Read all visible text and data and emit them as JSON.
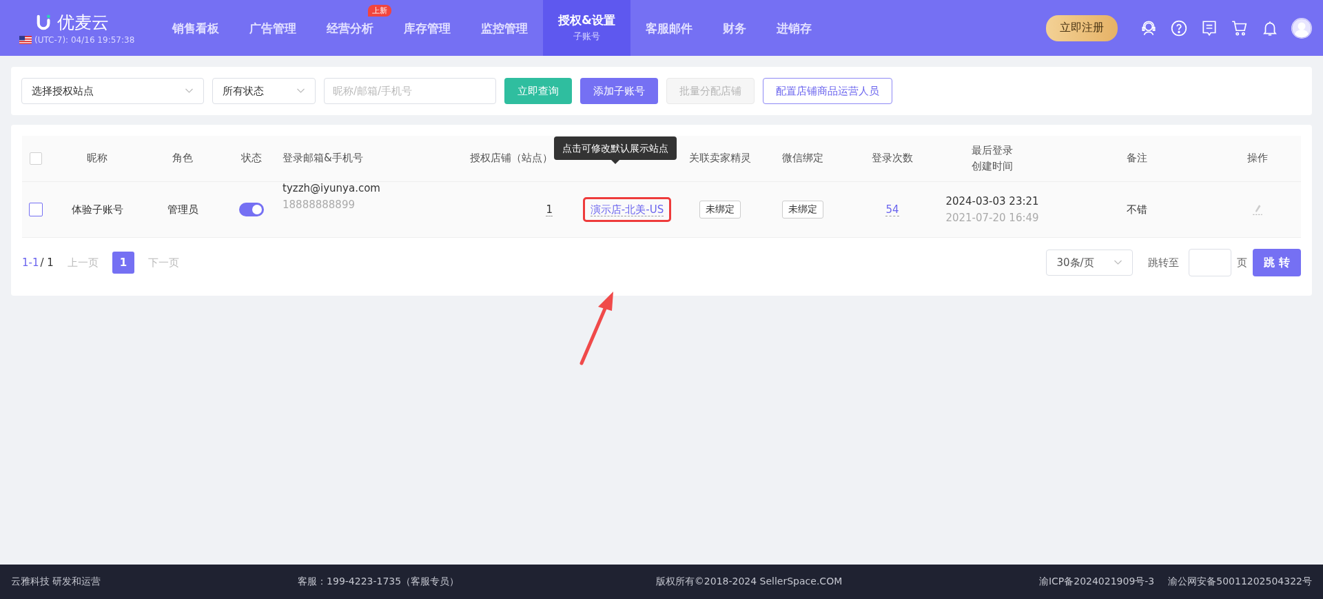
{
  "brand": {
    "name": "优麦云",
    "timezone": "(UTC-7): 04/16 19:57:38"
  },
  "nav": [
    {
      "label": "销售看板",
      "selected": false
    },
    {
      "label": "广告管理",
      "selected": false
    },
    {
      "label": "经营分析",
      "selected": false,
      "badge": "上新"
    },
    {
      "label": "库存管理",
      "selected": false
    },
    {
      "label": "监控管理",
      "selected": false
    },
    {
      "label": "授权&设置",
      "selected": true,
      "sub": "子账号"
    },
    {
      "label": "客服邮件",
      "selected": false
    },
    {
      "label": "财务",
      "selected": false
    },
    {
      "label": "进销存",
      "selected": false
    }
  ],
  "register_button": "立即注册",
  "filters": {
    "site_select": "选择授权站点",
    "status_select": "所有状态",
    "search": {
      "placeholder": "昵称/邮箱/手机号"
    },
    "buttons": [
      {
        "label": "立即查询",
        "kind": "query",
        "disabled": false
      },
      {
        "label": "添加子账号",
        "kind": "primary",
        "disabled": false
      },
      {
        "label": "批量分配店铺",
        "kind": "plain",
        "disabled": true
      },
      {
        "label": "配置店铺商品运营人员",
        "kind": "outline",
        "disabled": false
      }
    ]
  },
  "table": {
    "select_all_checked": false,
    "columns": [
      "昵称",
      "角色",
      "状态",
      "登录邮箱&手机号",
      "授权店铺（站点）",
      "",
      "关联卖家精灵",
      "微信绑定",
      "登录次数",
      [
        "最后登录",
        "创建时间"
      ],
      "备注",
      "操作"
    ],
    "rows": [
      {
        "checked": false,
        "nickname": "体验子账号",
        "role": "管理员",
        "enabled": true,
        "email": "tyzzh@iyunya.com",
        "phone": "18888888899",
        "shops": "1",
        "default_site": "演示店-北美-US",
        "seller_sprite": "未绑定",
        "wechat": "未绑定",
        "logins": "54",
        "last_login": "2024-03-03 23:21",
        "created": "2021-07-20 16:49",
        "note": "不错"
      }
    ]
  },
  "tooltip": "点击可修改默认展示站点",
  "pagination": {
    "range": "1-1",
    "total": "/ 1",
    "prev": "上一页",
    "pages": [
      {
        "label": "1",
        "selected": true
      }
    ],
    "next": "下一页",
    "page_size": "30条/页",
    "jump_label": "跳转至",
    "page_unit": "页",
    "jump_button": "跳 转"
  },
  "footer": [
    "云雅科技 研发和运营",
    "客服：199-4223-1735（客服专员）",
    "版权所有©2018-2024 SellerSpace.COM",
    "渝ICP备2024021909号-3",
    "渝公网安备50011202504322号"
  ]
}
